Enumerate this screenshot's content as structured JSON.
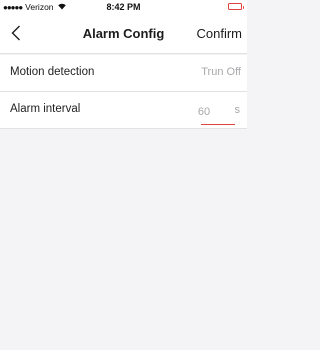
{
  "status_bar": {
    "signal": "●●●●●",
    "carrier": "Verizon",
    "time": "8:42 PM"
  },
  "navbar": {
    "title": "Alarm Config",
    "confirm_label": "Confirm"
  },
  "settings": {
    "motion_detection": {
      "label": "Motion detection",
      "value": "Trun Off"
    },
    "alarm_interval": {
      "label": "Alarm interval",
      "value": "60",
      "unit": "s"
    }
  },
  "colors": {
    "accent": "#e0443c",
    "background": "#f4f4f6",
    "secondary_text": "#a8a8ac"
  },
  "icons": {
    "back": "chevron-left-icon",
    "wifi": "wifi-icon",
    "battery": "battery-icon"
  }
}
